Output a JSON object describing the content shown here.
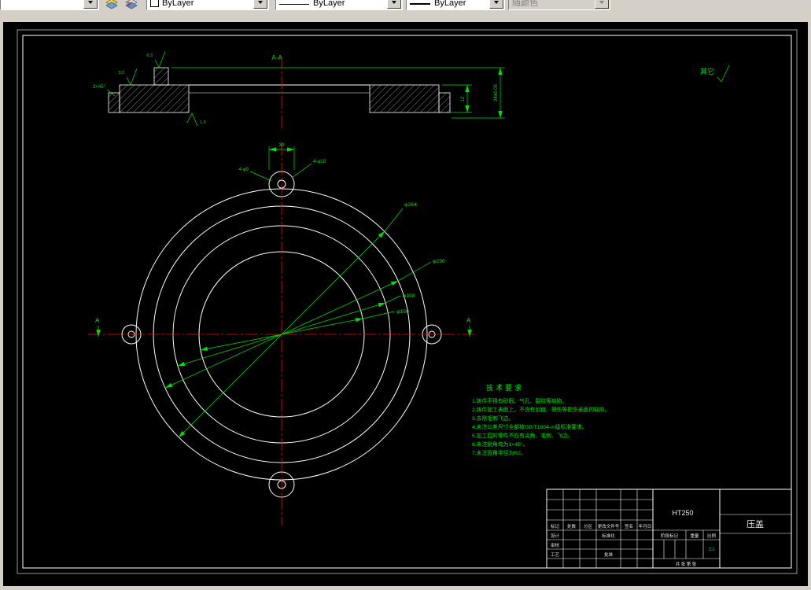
{
  "toolbar": {
    "color_value": "ByLayer",
    "linetype_value": "ByLayer",
    "lineweight_value": "ByLayer",
    "plotstyle_value": "随颜色"
  },
  "drawing": {
    "section_label": "A-A",
    "other_label": "其它",
    "dims": {
      "chamfer": "2×45°",
      "rough1": "3.2",
      "rough2": "6.3",
      "rough3": "1.6",
      "t_short": "12",
      "t_long": "24±0.05",
      "ear_width": "30",
      "ear_left": "4-φ9",
      "ear_right": "4-φ18",
      "d1": "φ264",
      "d2": "φ230",
      "d3": "φ198",
      "d4": "φ150",
      "marker_a": "A"
    },
    "tech": {
      "title": "技术要求",
      "items": [
        "1.铸件不得有砂眼、气孔、裂纹等缺陷。",
        "2.铸件加工表面上，不应有划痕、擦伤等损伤表面的缺陷。",
        "3.去除毛刺飞边。",
        "4.未注公差尺寸全部按GB/T1804-m级标准要求。",
        "5.加工后的零件不应有尖角、毛刺、飞边。",
        "6.未注倒角均为1×45°。",
        "7.未注圆角半径为R2。"
      ]
    }
  },
  "title_block": {
    "headers": [
      "标记",
      "处数",
      "分区",
      "更改文件号",
      "签名",
      "年月日"
    ],
    "design": "设计",
    "standard": "标准化",
    "audit": "审核",
    "process": "工艺",
    "approve": "批准",
    "stage": "阶段标记",
    "weight": "重量",
    "scale": "比例",
    "scale_value": "1:1",
    "sheet": "共  张  第  张",
    "material": "HT250",
    "part_name": "压盖"
  }
}
